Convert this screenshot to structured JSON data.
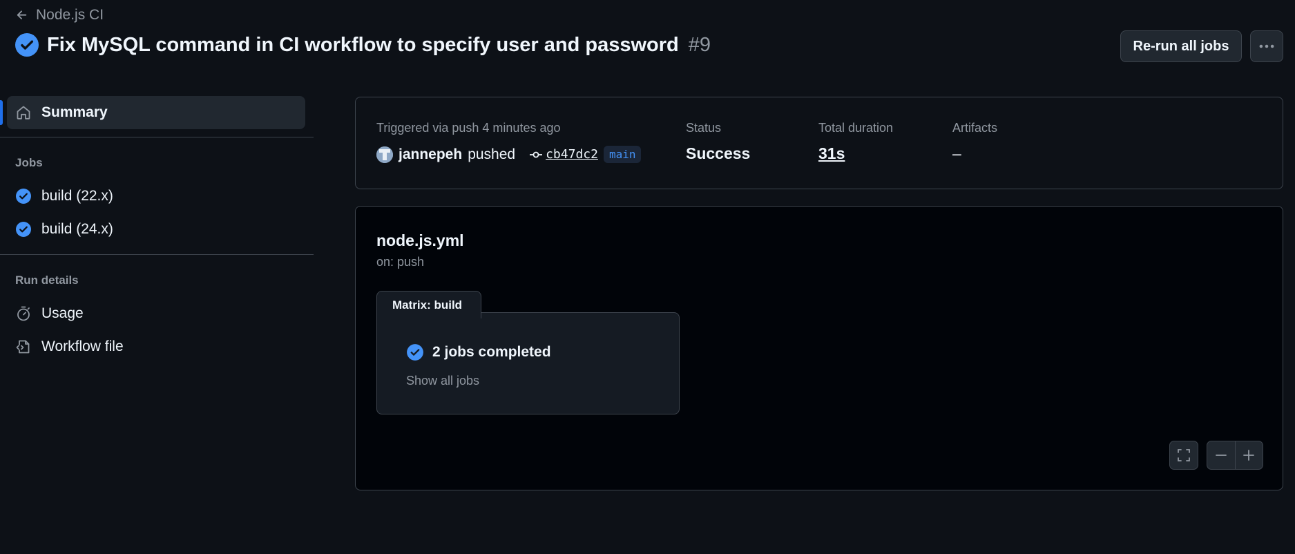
{
  "header": {
    "back_label": "Node.js CI",
    "title": "Fix MySQL command in CI workflow to specify user and password",
    "run_number": "#9",
    "rerun_label": "Re-run all jobs",
    "more_icon": "kebab-horizontal-icon"
  },
  "sidebar": {
    "summary_label": "Summary",
    "jobs_title": "Jobs",
    "jobs": [
      {
        "label": "build (22.x)",
        "status": "success"
      },
      {
        "label": "build (24.x)",
        "status": "success"
      }
    ],
    "run_details_title": "Run details",
    "run_details": [
      {
        "label": "Usage",
        "icon": "stopwatch-icon"
      },
      {
        "label": "Workflow file",
        "icon": "file-code-icon"
      }
    ]
  },
  "summary": {
    "trigger_text": "Triggered via push 4 minutes ago",
    "actor": "jannepeh",
    "action": "pushed",
    "commit_sha": "cb47dc2",
    "branch": "main",
    "status_label": "Status",
    "status_value": "Success",
    "duration_label": "Total duration",
    "duration_value": "31s",
    "artifacts_label": "Artifacts",
    "artifacts_value": "–"
  },
  "workflow": {
    "file_name": "node.js.yml",
    "trigger": "on: push",
    "matrix_label": "Matrix: build",
    "jobs_completed": "2 jobs completed",
    "show_all_jobs": "Show all jobs"
  },
  "colors": {
    "background": "#0d1117",
    "accent": "#1f6feb",
    "success": "#4493f8",
    "border": "#3d444d",
    "muted_text": "#9198a1"
  }
}
